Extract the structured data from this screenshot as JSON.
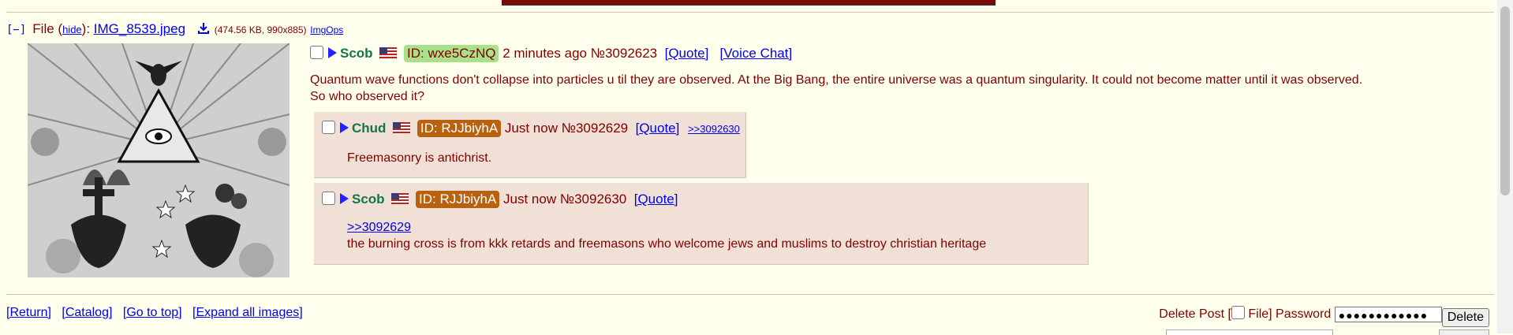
{
  "file": {
    "toggle": "[−]",
    "label": "File (",
    "hide": "hide",
    "label_end": "):",
    "filename": "IMG_8539.jpeg",
    "meta": "(474.56 KB, 990x885)",
    "imgops": "ImgOps"
  },
  "op": {
    "name": "Scob",
    "id_label": "ID: wxe5CzNQ",
    "id_color": "#a9e08a",
    "time": "2 minutes ago",
    "post_no": "№3092623",
    "quote": "[Quote]",
    "voice_chat": "[Voice Chat]",
    "line1": "Quantum wave functions don't collapse into particles u til they are observed. At the Big Bang, the entire universe was a quantum singularity. It could not become matter until it was observed.",
    "line2": "So who observed it?"
  },
  "reply1": {
    "name": "Chud",
    "id_label": "ID: RJJbiyhA",
    "id_color": "#b8620f",
    "time": "Just now",
    "post_no": "№3092629",
    "quote": "[Quote]",
    "backlink": ">>3092630",
    "message": "Freemasonry is antichrist."
  },
  "reply2": {
    "name": "Scob",
    "id_label": "ID: RJJbiyhA",
    "id_color": "#b8620f",
    "time": "Just now",
    "post_no": "№3092630",
    "quote": "[Quote]",
    "quotelink": ">>3092629",
    "message": "the burning cross is from kkk retards and freemasons who welcome jews and muslims to destroy christian heritage"
  },
  "nav": {
    "return": "[Return]",
    "catalog": "[Catalog]",
    "top": "[Go to top]",
    "expand": "[Expand all images]"
  },
  "delete_form": {
    "label": "Delete Post [",
    "file_label": "File]",
    "password_label": "Password",
    "password_value": "●●●●●●●●●●●●",
    "delete_button": "Delete"
  },
  "colors": {
    "background": "#ffffee",
    "reply_bg": "#f0e0d6",
    "name": "#117743",
    "text": "#800000",
    "link": "#0000ee"
  }
}
